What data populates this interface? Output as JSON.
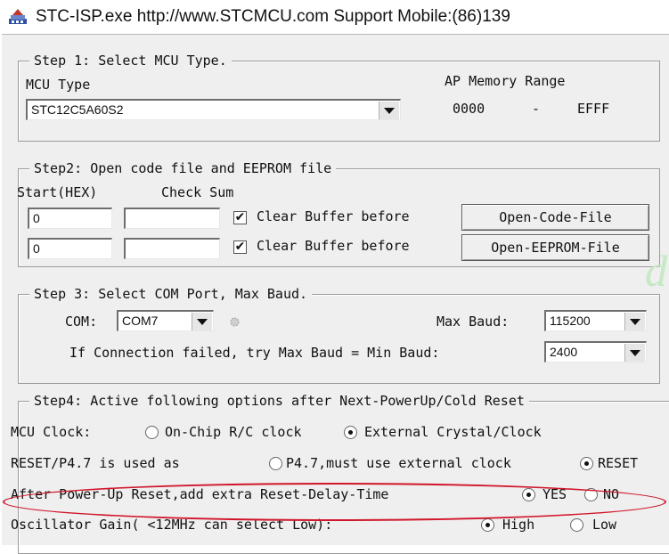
{
  "window": {
    "title": "STC-ISP.exe  http://www.STCMCU.com  Support Mobile:(86)139",
    "icon": "stc-isp-app-icon"
  },
  "step1": {
    "legend": "Step 1: Select MCU Type.",
    "mcu_type_label": "MCU Type",
    "mcu_type_value": "STC12C5A60S2",
    "ap_memory_label": "AP Memory Range",
    "ap_start": "0000",
    "ap_dash": "-",
    "ap_end": "EFFF"
  },
  "step2": {
    "legend": "Step2: Open code file and EEPROM file",
    "start_label": "Start(HEX)",
    "checksum_label": "Check Sum",
    "rows": [
      {
        "start": "0",
        "checksum": "",
        "clear_checked": true,
        "clear_label": "Clear Buffer before",
        "button": "Open-Code-File"
      },
      {
        "start": "0",
        "checksum": "",
        "clear_checked": true,
        "clear_label": "Clear Buffer before",
        "button": "Open-EEPROM-File"
      }
    ]
  },
  "step3": {
    "legend": "Step 3: Select COM Port, Max Baud.",
    "com_label": "COM:",
    "com_value": "COM7",
    "max_baud_label": "Max Baud:",
    "max_baud_value": "115200",
    "fail_label": "If Connection failed, try Max Baud = Min Baud:",
    "min_baud_value": "2400"
  },
  "step4": {
    "legend": "Step4: Active following options after Next-PowerUp/Cold Reset",
    "mcu_clock_label": "MCU Clock:",
    "mcu_clock_opt1": "On-Chip R/C clock",
    "mcu_clock_opt2": "External Crystal/Clock",
    "mcu_clock_selected": 2,
    "reset_label": "RESET/P4.7 is used as",
    "reset_opt1": "P4.7,must use external clock",
    "reset_opt2": "RESET",
    "reset_selected": 2,
    "delay_label": "After Power-Up Reset,add extra Reset-Delay-Time",
    "delay_opt1": "YES",
    "delay_opt2": "NO",
    "delay_selected": 1,
    "gain_label": "Oscillator Gain( <12MHz can select Low):",
    "gain_opt1": "High",
    "gain_opt2": "Low",
    "gain_selected": 1
  },
  "colors": {
    "highlight_oval": "#d0162a",
    "window_bg": "#efefef"
  }
}
